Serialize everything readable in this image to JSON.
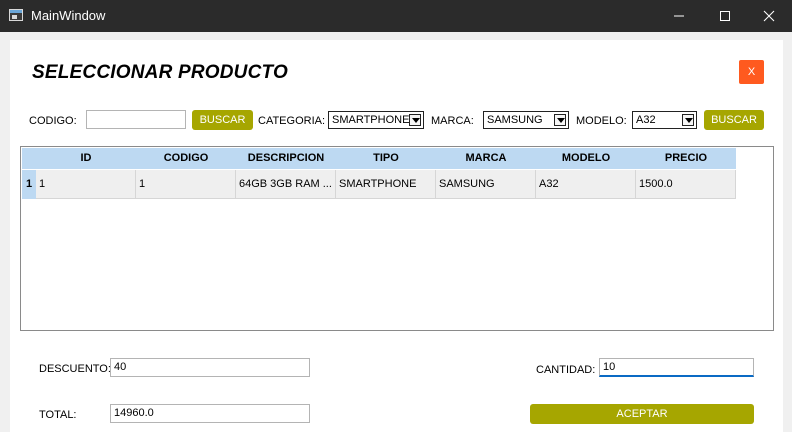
{
  "window": {
    "title": "MainWindow",
    "controls": [
      "minimize-icon",
      "maximize-icon",
      "close-icon"
    ]
  },
  "page": {
    "heading": "SELECCIONAR PRODUCTO",
    "close_label": "X",
    "accent_color": "#a6a600",
    "close_color": "#ff5a1f"
  },
  "filters": {
    "codigo_label": "CODIGO:",
    "codigo_value": "",
    "buscar1_label": "BUSCAR",
    "categoria_label": "CATEGORIA:",
    "categoria_value": "SMARTPHONE",
    "marca_label": "MARCA:",
    "marca_value": "SAMSUNG",
    "modelo_label": "MODELO:",
    "modelo_value": "A32",
    "buscar2_label": "BUSCAR"
  },
  "table": {
    "columns": [
      "ID",
      "CODIGO",
      "DESCRIPCION",
      "TIPO",
      "MARCA",
      "MODELO",
      "PRECIO"
    ],
    "rows": [
      {
        "row_number": "1",
        "cells": [
          "1",
          "1",
          "64GB 3GB RAM ...",
          "SMARTPHONE",
          "SAMSUNG",
          "A32",
          "1500.0"
        ]
      }
    ]
  },
  "footer": {
    "descuento_label": "DESCUENTO:",
    "descuento_value": "40",
    "cantidad_label": "CANTIDAD:",
    "cantidad_value": "10",
    "total_label": "TOTAL:",
    "total_value": "14960.0",
    "aceptar_label": "ACEPTAR"
  }
}
